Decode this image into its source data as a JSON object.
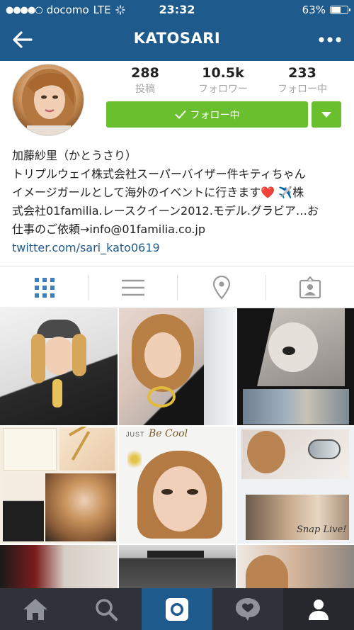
{
  "status_bar": {
    "signal": "●●●●○",
    "carrier": "docomo",
    "network": "LTE",
    "time": "23:32",
    "battery_text": "63%",
    "battery_level": 0.63
  },
  "nav": {
    "title": "KATOSARI",
    "back_icon": "arrow-left-icon",
    "more_icon": "more-horizontal-icon"
  },
  "profile": {
    "stats": [
      {
        "value": "288",
        "label": "投稿"
      },
      {
        "value": "10.5k",
        "label": "フォロワー"
      },
      {
        "value": "233",
        "label": "フォロー中"
      }
    ],
    "follow_label": "フォロー中",
    "bio": {
      "name": "加藤紗里（かとうさり）",
      "line_1": "トリプルウェイ株式会社スーパーバイザー件キティちゃん",
      "line_2_before": "イメージガールとして海外のイベントに行きます",
      "line_2_heart": "❤️",
      "line_2_plane": "✈️",
      "line_2_after": "株",
      "line_3": "式会社01familia.レースクイーン2012.モデル.グラビア…お",
      "line_4": "仕事のご依頼→info@01familia.co.jp",
      "link": "twitter.com/sari_kato0619"
    }
  },
  "view_tabs": [
    {
      "name": "grid-view-icon",
      "active": true
    },
    {
      "name": "list-view-icon",
      "active": false
    },
    {
      "name": "location-pin-icon",
      "active": false
    },
    {
      "name": "tagged-photos-icon",
      "active": false
    }
  ],
  "photos": {
    "script_text_1": "Be Cool",
    "script_text_2": "Snap Live!",
    "small_text_1": "JUST"
  },
  "tabbar": [
    {
      "name": "home-icon"
    },
    {
      "name": "search-icon"
    },
    {
      "name": "camera-icon"
    },
    {
      "name": "activity-heart-icon"
    },
    {
      "name": "profile-icon"
    }
  ],
  "colors": {
    "nav_blue": "#1f5a8c",
    "follow_green": "#6abf2e",
    "tabbar_dark": "#2f3238",
    "link_blue": "#1f5a8c",
    "active_tab_blue": "#3c7ec0"
  }
}
